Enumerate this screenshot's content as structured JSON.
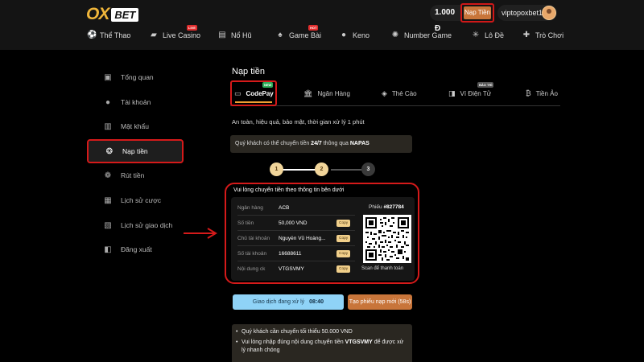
{
  "header": {
    "logo_ox": "OX",
    "logo_bet": "BET",
    "balance": "1.000 Đ",
    "deposit_button": "Nạp Tiền",
    "username": "viptopoxbet1"
  },
  "nav": [
    {
      "label": "Thể Thao",
      "icon": "soccer-ball-icon",
      "badge": ""
    },
    {
      "label": "Live Casino",
      "icon": "mask-icon",
      "badge": "LIVE"
    },
    {
      "label": "Nổ Hũ",
      "icon": "slot-icon",
      "badge": ""
    },
    {
      "label": "Game Bài",
      "icon": "spade-icon",
      "badge": "HOT"
    },
    {
      "label": "Keno",
      "icon": "keno-ball-icon",
      "badge": ""
    },
    {
      "label": "Number Game",
      "icon": "number-ball-icon",
      "badge": ""
    },
    {
      "label": "Lô Đề",
      "icon": "lottery-icon",
      "badge": ""
    },
    {
      "label": "Trò Chơi",
      "icon": "gamepad-icon",
      "badge": ""
    }
  ],
  "sidebar": {
    "items": [
      {
        "label": "Tổng quan",
        "icon": "overview-icon"
      },
      {
        "label": "Tài khoản",
        "icon": "user-icon"
      },
      {
        "label": "Mật khẩu",
        "icon": "lock-icon"
      },
      {
        "label": "Nạp tiền",
        "icon": "deposit-icon"
      },
      {
        "label": "Rút tiền",
        "icon": "withdraw-icon"
      },
      {
        "label": "Lịch sử cược",
        "icon": "bet-history-icon"
      },
      {
        "label": "Lịch sử giao dịch",
        "icon": "transaction-history-icon"
      },
      {
        "label": "Đăng xuất",
        "icon": "logout-icon"
      }
    ],
    "active_index": 3
  },
  "main": {
    "title": "Nạp tiền",
    "tabs": [
      {
        "label": "CodePay",
        "badge": "NEW"
      },
      {
        "label": "Ngân Hàng",
        "badge": ""
      },
      {
        "label": "Thẻ Cào",
        "badge": ""
      },
      {
        "label": "Ví Điện Tử",
        "badge": "BẢO TRÌ"
      },
      {
        "label": "Tiền Ảo",
        "badge": ""
      }
    ],
    "subtitle": "An toàn, hiệu quả, bảo mật, thời gian xử lý 1 phút",
    "napas_pre": "Quý khách có thể chuyển tiền ",
    "napas_bold1": "24/7",
    "napas_mid": " thông qua ",
    "napas_bold2": "NAPAS",
    "steps": [
      "1",
      "2",
      "3"
    ],
    "transfer": {
      "title": "Vui lòng chuyển tiền theo thông tin bên dưới",
      "rows": [
        {
          "label": "Ngân hàng",
          "value": "ACB",
          "copy": ""
        },
        {
          "label": "Số tiền",
          "value": "50,000 VND",
          "copy": "Copy"
        },
        {
          "label": "Chủ tài khoản",
          "value": "Nguyễn Vũ Hoàng...",
          "copy": "Copy"
        },
        {
          "label": "Số tài khoản",
          "value": "16688611",
          "copy": "Copy"
        },
        {
          "label": "Nội dung ck",
          "value": "VTGSVMY",
          "copy": "Copy"
        }
      ],
      "ticket_label": "Phiếu ",
      "ticket_number": "#827784",
      "scan_label": "Scan để thanh toán"
    },
    "wait_button": "Giao dịch đang xử lý",
    "wait_time": "08:40",
    "new_button": "Tạo phiếu nạp mới (58s)",
    "notes": [
      {
        "pre": "Quý khách cần chuyển tối thiểu 50.000 VND",
        "bold": "",
        "post": ""
      },
      {
        "pre": "Vui lòng nhập đúng nội dung chuyển tiền ",
        "bold": "VTGSVMY",
        "post": " để được xử lý nhanh chóng"
      }
    ]
  },
  "colors": {
    "accent": "#f0a032",
    "highlight": "#d51a1a",
    "deposit_button": "#c8753a",
    "wait_button": "#8fd3f7"
  }
}
